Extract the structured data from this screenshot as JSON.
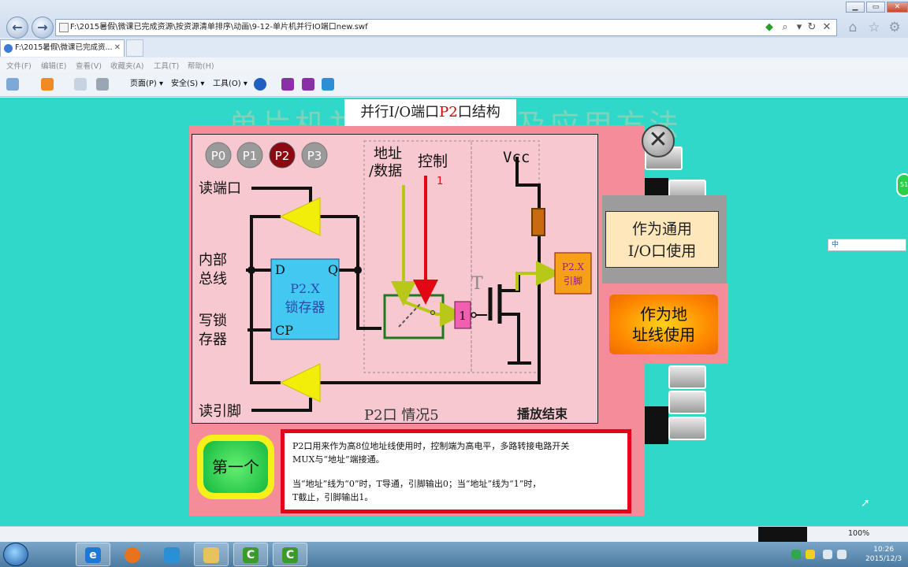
{
  "window": {
    "address": "F:\\2015暑假\\微课已完成资源\\按资源清单排序\\动画\\9-12-单片机并行IO端口new.swf",
    "tab_title": "F:\\2015暑假\\微课已完成资...",
    "controls": {
      "minimize": "▁",
      "maximize": "▭",
      "close": "✕"
    }
  },
  "menu": [
    "文件(F)",
    "编辑(E)",
    "查看(V)",
    "收藏夹(A)",
    "工具(T)",
    "帮助(H)"
  ],
  "commandbar": {
    "page": "页面(P) ▾",
    "safety": "安全(S) ▾",
    "tools": "工具(O) ▾"
  },
  "slide": {
    "bg_title": "单片机并行I/O端口及应用方法",
    "top_label_prefix": "并行I/O端口",
    "top_label_highlight": "P2",
    "top_label_suffix": "口结构"
  },
  "diagram": {
    "port_buttons": [
      "P0",
      "P1",
      "P2",
      "P3"
    ],
    "active_port": "P2",
    "labels": {
      "read_port": "读端口",
      "internal_bus_1": "内部",
      "internal_bus_2": "总线",
      "write_latch_1": "写锁",
      "write_latch_2": "存器",
      "read_pin": "读引脚",
      "addr_1": "地址",
      "addr_2": "/数据",
      "control": "控制",
      "control_value": "1",
      "vcc": "Vcc",
      "latch_d": "D",
      "latch_q": "Q",
      "latch_cp": "CP",
      "latch_name_1": "P2.X",
      "latch_name_2": "锁存器",
      "inverter": "1",
      "transistor": "T",
      "pin_1": "P2.X",
      "pin_2": "引脚",
      "status": "P2口 情况5",
      "end": "播放结束"
    }
  },
  "buttons": {
    "first": "第一个",
    "io_use": "作为通用\nI/O口使用",
    "addr_use": "作为地\n址线使用",
    "close": "✕"
  },
  "description": {
    "p1_line1": "P2口用来作为高8位地址线使用时，控制端为高电平，多路转接电路开关",
    "p1_line2": "MUX与“地址”端接通。",
    "p2_line1": "当“地址”线为“0”时，T导通，引脚输出0；当“地址”线为“1”时，",
    "p2_line2": "T截止，引脚输出1。"
  },
  "floating_bar": "中",
  "edge_badge": "51",
  "status": {
    "zoom": "100%"
  },
  "clock": {
    "time": "10:26",
    "date": "2015/12/3"
  },
  "colors": {
    "page_bg": "#2fd8c8",
    "panel": "#f48c9a",
    "diagram_bg": "#f7c8cf",
    "latch": "#43c8f2",
    "arrow_yellow": "#f2ee0a",
    "signal_olive": "#b8c818",
    "control_red": "#e30613",
    "mux_border": "#1f7a1f",
    "accent_red": "#e8001a"
  },
  "icons": [
    "back-icon",
    "forward-icon",
    "refresh-icon",
    "stop-icon",
    "home-icon",
    "favorites-icon",
    "settings-icon",
    "search-icon"
  ]
}
